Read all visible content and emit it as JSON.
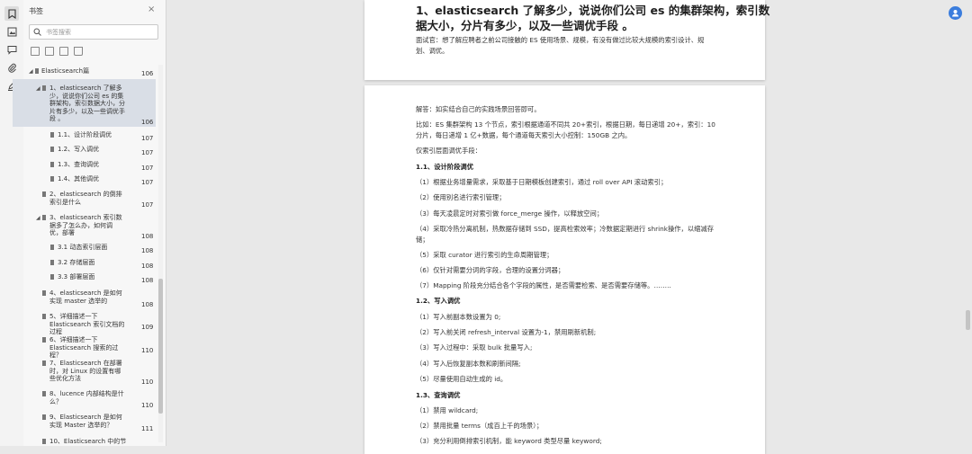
{
  "sidebar": {
    "title": "书签",
    "close": "×",
    "search_placeholder": "书签搜索",
    "items": [
      {
        "label": "Elasticsearch篇",
        "page": "106"
      },
      {
        "label": "1、elasticsearch 了解多少，说说你们公司 es 的集群架构，索引数据大小，分片有多少，以及一些调优手段 。",
        "page": "106"
      },
      {
        "label": "1.1、设计阶段调优",
        "page": "107"
      },
      {
        "label": "1.2、写入调优",
        "page": "107"
      },
      {
        "label": "1.3、查询调优",
        "page": "107"
      },
      {
        "label": "1.4、其他调优",
        "page": "107"
      },
      {
        "label": "2、elasticsearch 的倒排索引是什么",
        "page": "107"
      },
      {
        "label": "3、elasticsearch 索引数据多了怎么办，如何调优，部署",
        "page": "108"
      },
      {
        "label": "3.1 动态索引层面",
        "page": "108"
      },
      {
        "label": "3.2 存储层面",
        "page": "108"
      },
      {
        "label": "3.3 部署层面",
        "page": "108"
      },
      {
        "label": "4、elasticsearch 是如何实现 master 选举的",
        "page": "108"
      },
      {
        "label": "5、详细描述一下 Elasticsearch 索引文档的过程",
        "page": "109"
      },
      {
        "label": "6、详细描述一下 Elasticsearch 搜索的过程？",
        "page": "110"
      },
      {
        "label": "7、Elasticsearch 在部署时，对 Linux 的设置有哪些优化方法",
        "page": "110"
      },
      {
        "label": "8、lucence 内部结构是什么？",
        "page": "110"
      },
      {
        "label": "9、Elasticsearch 是如何实现 Master 选举的？",
        "page": "111"
      },
      {
        "label": "10、Elasticsearch 中的节",
        "page": ""
      }
    ]
  },
  "doc": {
    "heading_line1": "1、elasticsearch 了解多少，说说你们公司 es 的集群架构，索引数",
    "heading_line2": "据大小，分片有多少，以及一些调优手段 。",
    "intro_line1": "面试官：想了解应聘者之前公司接触的 ES 使用场景、规模，有没有做过比较大规模的索引设计、规",
    "intro_line2": "划、调优。",
    "lines": [
      "解答：如实结合自己的实践场景回答即可。",
      "比如：ES 集群架构 13 个节点，索引根据通道不同共 20+索引，根据日期，每日递增 20+，索引：10",
      "分片，每日递增 1 亿+数据，每个通道每天索引大小控制：150GB 之内。",
      "仅索引层面调优手段：",
      "1.1、设计阶段调优",
      "（1）根据业务增量需求，采取基于日期模板创建索引，通过 roll over API 滚动索引；",
      "（2）使用别名进行索引管理；",
      "（3）每天凌晨定时对索引做 force_merge 操作，以释放空间；",
      "（4）采取冷热分离机制，热数据存储到 SSD，提高检索效率；冷数据定期进行 shrink操作，以缩减存",
      "储；",
      "（5）采取 curator 进行索引的生命周期管理；",
      "（6）仅针对需要分词的字段，合理的设置分词器；",
      "（7）Mapping 阶段充分结合各个字段的属性，是否需要检索、是否需要存储等。……..",
      "1.2、写入调优",
      "（1）写入前副本数设置为 0;",
      "（2）写入前关闭 refresh_interval 设置为-1，禁用刷新机制;",
      "（3）写入过程中：采取 bulk 批量写入;",
      "（4）写入后恢复副本数和刷新间隔;",
      "（5）尽量使用自动生成的 id。",
      "1.3、查询调优",
      "（1）禁用 wildcard;",
      "（2）禁用批量 terms（成百上千的场景）；",
      "（3）充分利用倒排索引机制，能 keyword 类型尽量 keyword;"
    ]
  },
  "colors": {
    "accent": "#3b7ddd",
    "selection": "#d9dee6"
  }
}
